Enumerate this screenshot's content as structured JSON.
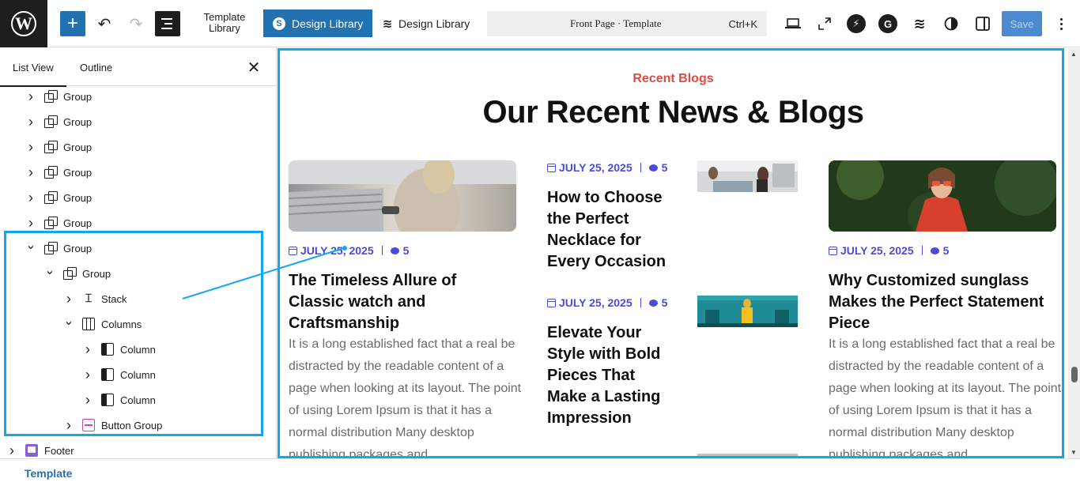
{
  "toolbar": {
    "template_library_label": "Template\nLibrary",
    "design_library_primary": "Design Library",
    "design_library_secondary": "Design Library",
    "command_title": "Front Page · Template",
    "command_shortcut": "Ctrl+K",
    "save_label": "Save"
  },
  "sidebar": {
    "tabs": {
      "list_view": "List View",
      "outline": "Outline"
    },
    "tree": [
      {
        "label": "Group",
        "icon": "group-icon",
        "expanded": false
      },
      {
        "label": "Group",
        "icon": "group-icon",
        "expanded": false
      },
      {
        "label": "Group",
        "icon": "group-icon",
        "expanded": false
      },
      {
        "label": "Group",
        "icon": "group-icon",
        "expanded": false
      },
      {
        "label": "Group",
        "icon": "group-icon",
        "expanded": false
      },
      {
        "label": "Group",
        "icon": "group-icon",
        "expanded": false
      },
      {
        "label": "Group",
        "icon": "group-icon",
        "expanded": true
      },
      {
        "label": "Group",
        "icon": "group-icon",
        "expanded": true
      },
      {
        "label": "Stack",
        "icon": "stack-icon",
        "expanded": false
      },
      {
        "label": "Columns",
        "icon": "columns-icon",
        "expanded": true
      },
      {
        "label": "Column",
        "icon": "column-icon",
        "expanded": false
      },
      {
        "label": "Column",
        "icon": "column-icon",
        "expanded": false
      },
      {
        "label": "Column",
        "icon": "column-icon",
        "expanded": false
      },
      {
        "label": "Button Group",
        "icon": "button-group-icon",
        "expanded": false
      },
      {
        "label": "Footer",
        "icon": "footer-icon",
        "expanded": false
      }
    ]
  },
  "breadcrumb": {
    "current": "Template"
  },
  "canvas": {
    "eyebrow": "Recent Blogs",
    "heading": "Our Recent News & Blogs",
    "posts": [
      {
        "date": "JULY 25, 2025",
        "comments": "5",
        "title": "The Timeless Allure of Classic watch and Craftsmanship",
        "excerpt": "It is a long established fact that a real be distracted by the readable content of a page when looking at its layout. The point of using Lorem Ipsum is that it has a normal distribution Many desktop publishing packages and"
      },
      {
        "date": "JULY 25, 2025",
        "comments": "5",
        "title": "How to Choose the Perfect Necklace for Every Occasion"
      },
      {
        "date": "JULY 25, 2025",
        "comments": "5",
        "title": "Elevate Your Style with Bold Pieces That Make a Lasting Impression"
      },
      {
        "date": "JULY 25, 2025",
        "comments": "5",
        "title": "Why Customized sunglass Makes the Perfect Statement Piece",
        "excerpt": "It is a long established fact that a real be distracted by the readable content of a page when looking at its layout. The point of using Lorem Ipsum is that it has a normal distribution Many desktop publishing packages and"
      }
    ]
  },
  "colors": {
    "accent_blue": "#2271b1",
    "selection_blue": "#12a8f0",
    "eyebrow_red": "#e24a40",
    "meta_purple": "#4a4bd6"
  }
}
